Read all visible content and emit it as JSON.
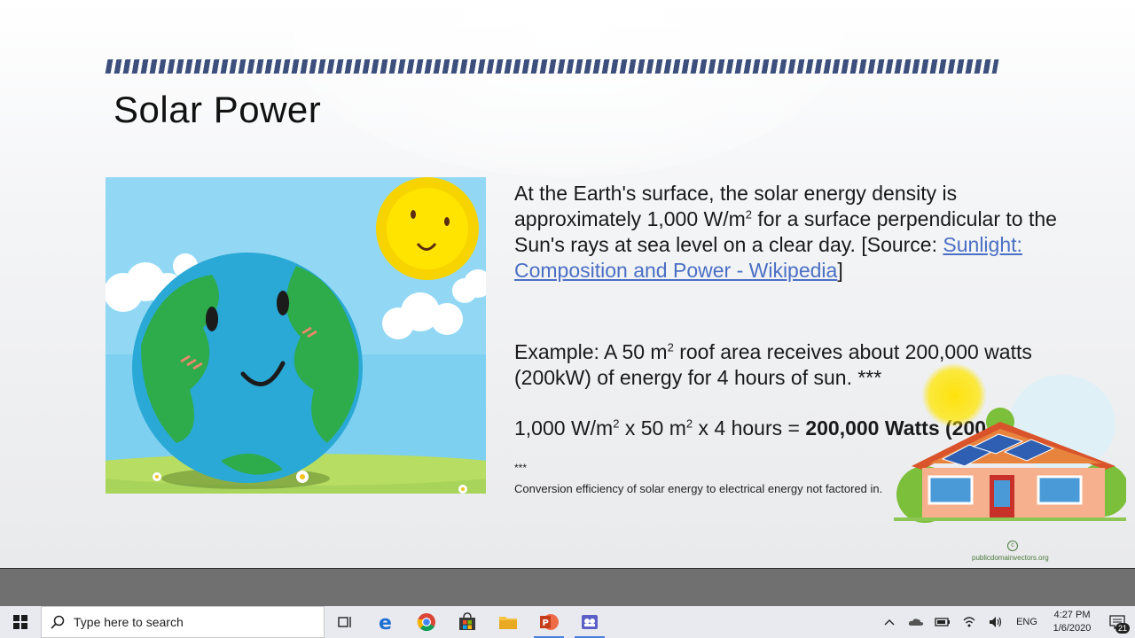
{
  "slide": {
    "title": "Solar Power",
    "body_part1": "At the Earth's surface, the solar energy density is approximately 1,000 W/m",
    "body_sup1": "2",
    "body_part2": " for a surface perpendicular to the Sun's rays at sea level on a clear day. [Source: ",
    "source_link": "Sunlight: Composition and Power - Wikipedia",
    "body_part3": "]",
    "example_a": "Example: A 50 m",
    "example_sup": "2",
    "example_b": " roof area receives about 200,000 watts (200kW) of energy for 4 hours of sun. ***",
    "formula_a": "1,000 W/m",
    "formula_sup1": "2",
    "formula_b": " x 50 m",
    "formula_sup2": "2",
    "formula_c": " x 4 hours = ",
    "formula_result": "200,000 Watts (200kW)",
    "footnote_mark": "***",
    "footnote": "Conversion efficiency of solar energy to electrical energy not factored in.",
    "image_credit": "publicdomainvectors.org"
  },
  "taskbar": {
    "search_placeholder": "Type here to search",
    "apps": [
      "task-view",
      "edge",
      "chrome",
      "store",
      "file-explorer",
      "powerpoint",
      "teams"
    ],
    "tray": {
      "language": "ENG",
      "time": "4:27 PM",
      "date": "1/6/2020",
      "notification_count": "21"
    }
  },
  "colors": {
    "deco_bar": "#3d4f7c",
    "link": "#4a6fc4",
    "taskbar": "#e8eaf0",
    "pointer_highlight": "#ffe100"
  }
}
